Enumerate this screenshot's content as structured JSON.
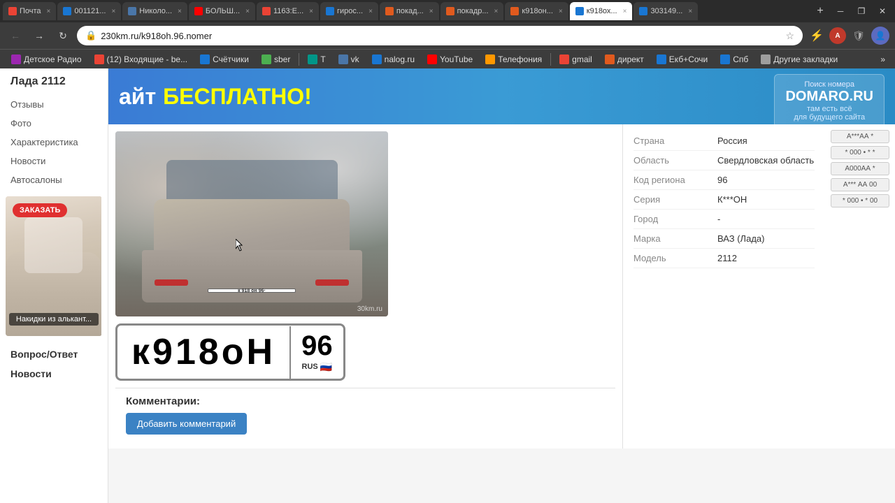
{
  "browser": {
    "address": "230km.ru/k918oh.96.nomer",
    "tabs": [
      {
        "label": "Почта",
        "favicon_color": "fav-mail",
        "active": false
      },
      {
        "label": "001121...",
        "favicon_color": "fav-blue",
        "active": false
      },
      {
        "label": "Николо...",
        "favicon_color": "fav-vk",
        "active": false
      },
      {
        "label": "БОЛЬШ...",
        "favicon_color": "fav-yt",
        "active": false
      },
      {
        "label": "1163:Е...",
        "favicon_color": "fav-mail",
        "active": false
      },
      {
        "label": "гирос...",
        "favicon_color": "fav-blue",
        "active": false
      },
      {
        "label": "покад...",
        "favicon_color": "fav-yandex",
        "active": false
      },
      {
        "label": "покадр...",
        "favicon_color": "fav-yandex",
        "active": false
      },
      {
        "label": "к918он...",
        "favicon_color": "fav-yandex",
        "active": false
      },
      {
        "label": "к918ох...",
        "favicon_color": "fav-blue",
        "active": true
      },
      {
        "label": "303149...",
        "favicon_color": "fav-blue",
        "active": false
      }
    ]
  },
  "bookmarks": [
    {
      "label": "Детское Радио",
      "favicon_color": "fav-purple"
    },
    {
      "label": "(12) Входящие - be...",
      "favicon_color": "fav-mail"
    },
    {
      "label": "Счётчики",
      "favicon_color": "fav-blue"
    },
    {
      "label": "sber",
      "favicon_color": "fav-green"
    },
    {
      "label": "Т",
      "favicon_color": "fav-teal"
    },
    {
      "label": "vk",
      "favicon_color": "fav-vk"
    },
    {
      "label": "nalog.ru",
      "favicon_color": "fav-blue"
    },
    {
      "label": "YouTube",
      "favicon_color": "fav-yt"
    },
    {
      "label": "Телефония",
      "favicon_color": "fav-orange"
    },
    {
      "label": "gmail",
      "favicon_color": "fav-mail"
    },
    {
      "label": "директ",
      "favicon_color": "fav-yandex"
    },
    {
      "label": "Екб+Сочи",
      "favicon_color": "fav-blue"
    },
    {
      "label": "Спб",
      "favicon_color": "fav-blue"
    },
    {
      "label": "Другие закладки",
      "favicon_color": "fav-gray"
    }
  ],
  "sidebar": {
    "title": "Лада 2112",
    "menu_items": [
      "Отзывы",
      "Фото",
      "Характеристика",
      "Новости",
      "Автосалоны"
    ],
    "ad_button": "ЗАКАЗАТЬ",
    "ad_caption": "Накидки из алькант...",
    "section_links": [
      "Вопрос/Ответ",
      "Новости"
    ]
  },
  "banner": {
    "text1": "айт",
    "text2": "БЕСПЛАТНО!",
    "search_label": "Поиск номера",
    "domain": "DOMARO.RU",
    "tagline1": "там есть всё",
    "tagline2": "для будущего сайта"
  },
  "car_photo": {
    "plate_text": "к 918 он 96·",
    "watermark": "30km.ru"
  },
  "plate": {
    "main": "к918оН",
    "region": "96",
    "rus": "RUS"
  },
  "info_table": {
    "rows": [
      {
        "label": "Страна",
        "value": "Россия"
      },
      {
        "label": "Область",
        "value": "Свердловская область"
      },
      {
        "label": "Код региона",
        "value": "96"
      },
      {
        "label": "Серия",
        "value": "К***ОН"
      },
      {
        "label": "Город",
        "value": "-"
      },
      {
        "label": "Марка",
        "value": "ВАЗ (Лада)"
      },
      {
        "label": "Модель",
        "value": "2112"
      }
    ]
  },
  "plate_variants": [
    "А***АА *",
    "* 000 • * *",
    "А000АА *",
    "А*** АА 00",
    "* 000 • * 00"
  ],
  "comments": {
    "title": "Комментарии:",
    "add_button": "Добавить комментарий"
  }
}
